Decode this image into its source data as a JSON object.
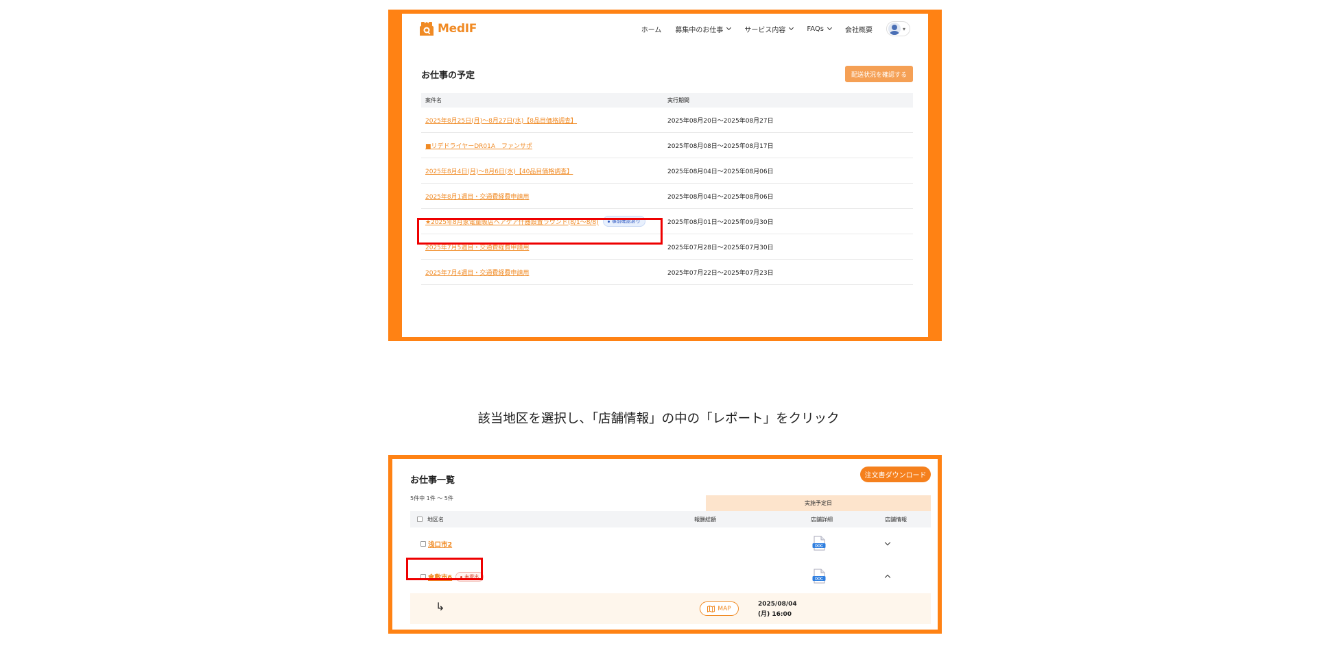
{
  "app": {
    "logo_text": "MedIF"
  },
  "nav": {
    "items": [
      "ホーム",
      "募集中のお仕事",
      "サービス内容",
      "FAQs",
      "会社概要"
    ]
  },
  "schedule": {
    "title": "お仕事の予定",
    "action_button": "配送状況を確認する",
    "columns": [
      "案件名",
      "実行期間"
    ],
    "rows": [
      {
        "name": "2025年8月25日(月)～8月27日(水)【8品目価格調査】",
        "period": "2025年08月20日～2025年08月27日"
      },
      {
        "name": "■リデドライヤーDR01A　ファンサポ",
        "period": "2025年08月08日～2025年08月17日"
      },
      {
        "name": "2025年8月4日(月)～8月6日(水)【40品目価格調査】",
        "period": "2025年08月04日～2025年08月06日"
      },
      {
        "name": "2025年8月1週目・交通費経費申請用",
        "period": "2025年08月04日～2025年08月06日"
      },
      {
        "name": "★2025年8月家電量販店ヘアケア什器設置ラウンド(8/1～8/8)",
        "tag": "事前確認あり",
        "period": "2025年08月01日～2025年09月30日"
      },
      {
        "name": "2025年7月5週目・交通費経費申請用",
        "period": "2025年07月28日～2025年07月30日"
      },
      {
        "name": "2025年7月4週目・交通費経費申請用",
        "period": "2025年07月22日～2025年07月23日"
      }
    ]
  },
  "caption": "該当地区を選択し、「店舗情報」の中の「レポート」をクリック",
  "job_list": {
    "title": "お仕事一覧",
    "download_button": "注文書ダウンロード",
    "count_text": "5件中 1件 ～ 5件",
    "date_header": "実施予定日",
    "columns": {
      "district": "地区名",
      "report": "報酬総額",
      "detail": "店舗詳細",
      "info": "店舗情報"
    },
    "rows": [
      {
        "district": "浅口市2",
        "doc_label": "DOC"
      },
      {
        "district": "倉敷市6",
        "tag": "未提出",
        "doc_label": "DOC"
      }
    ],
    "sub_row": {
      "map_label": "MAP",
      "date_line1": "2025/08/04",
      "date_line2": "(月) 16:00"
    }
  },
  "colors": {
    "frame": "#ff8214",
    "accent": "#f08a24",
    "highlight": "#e00000"
  }
}
